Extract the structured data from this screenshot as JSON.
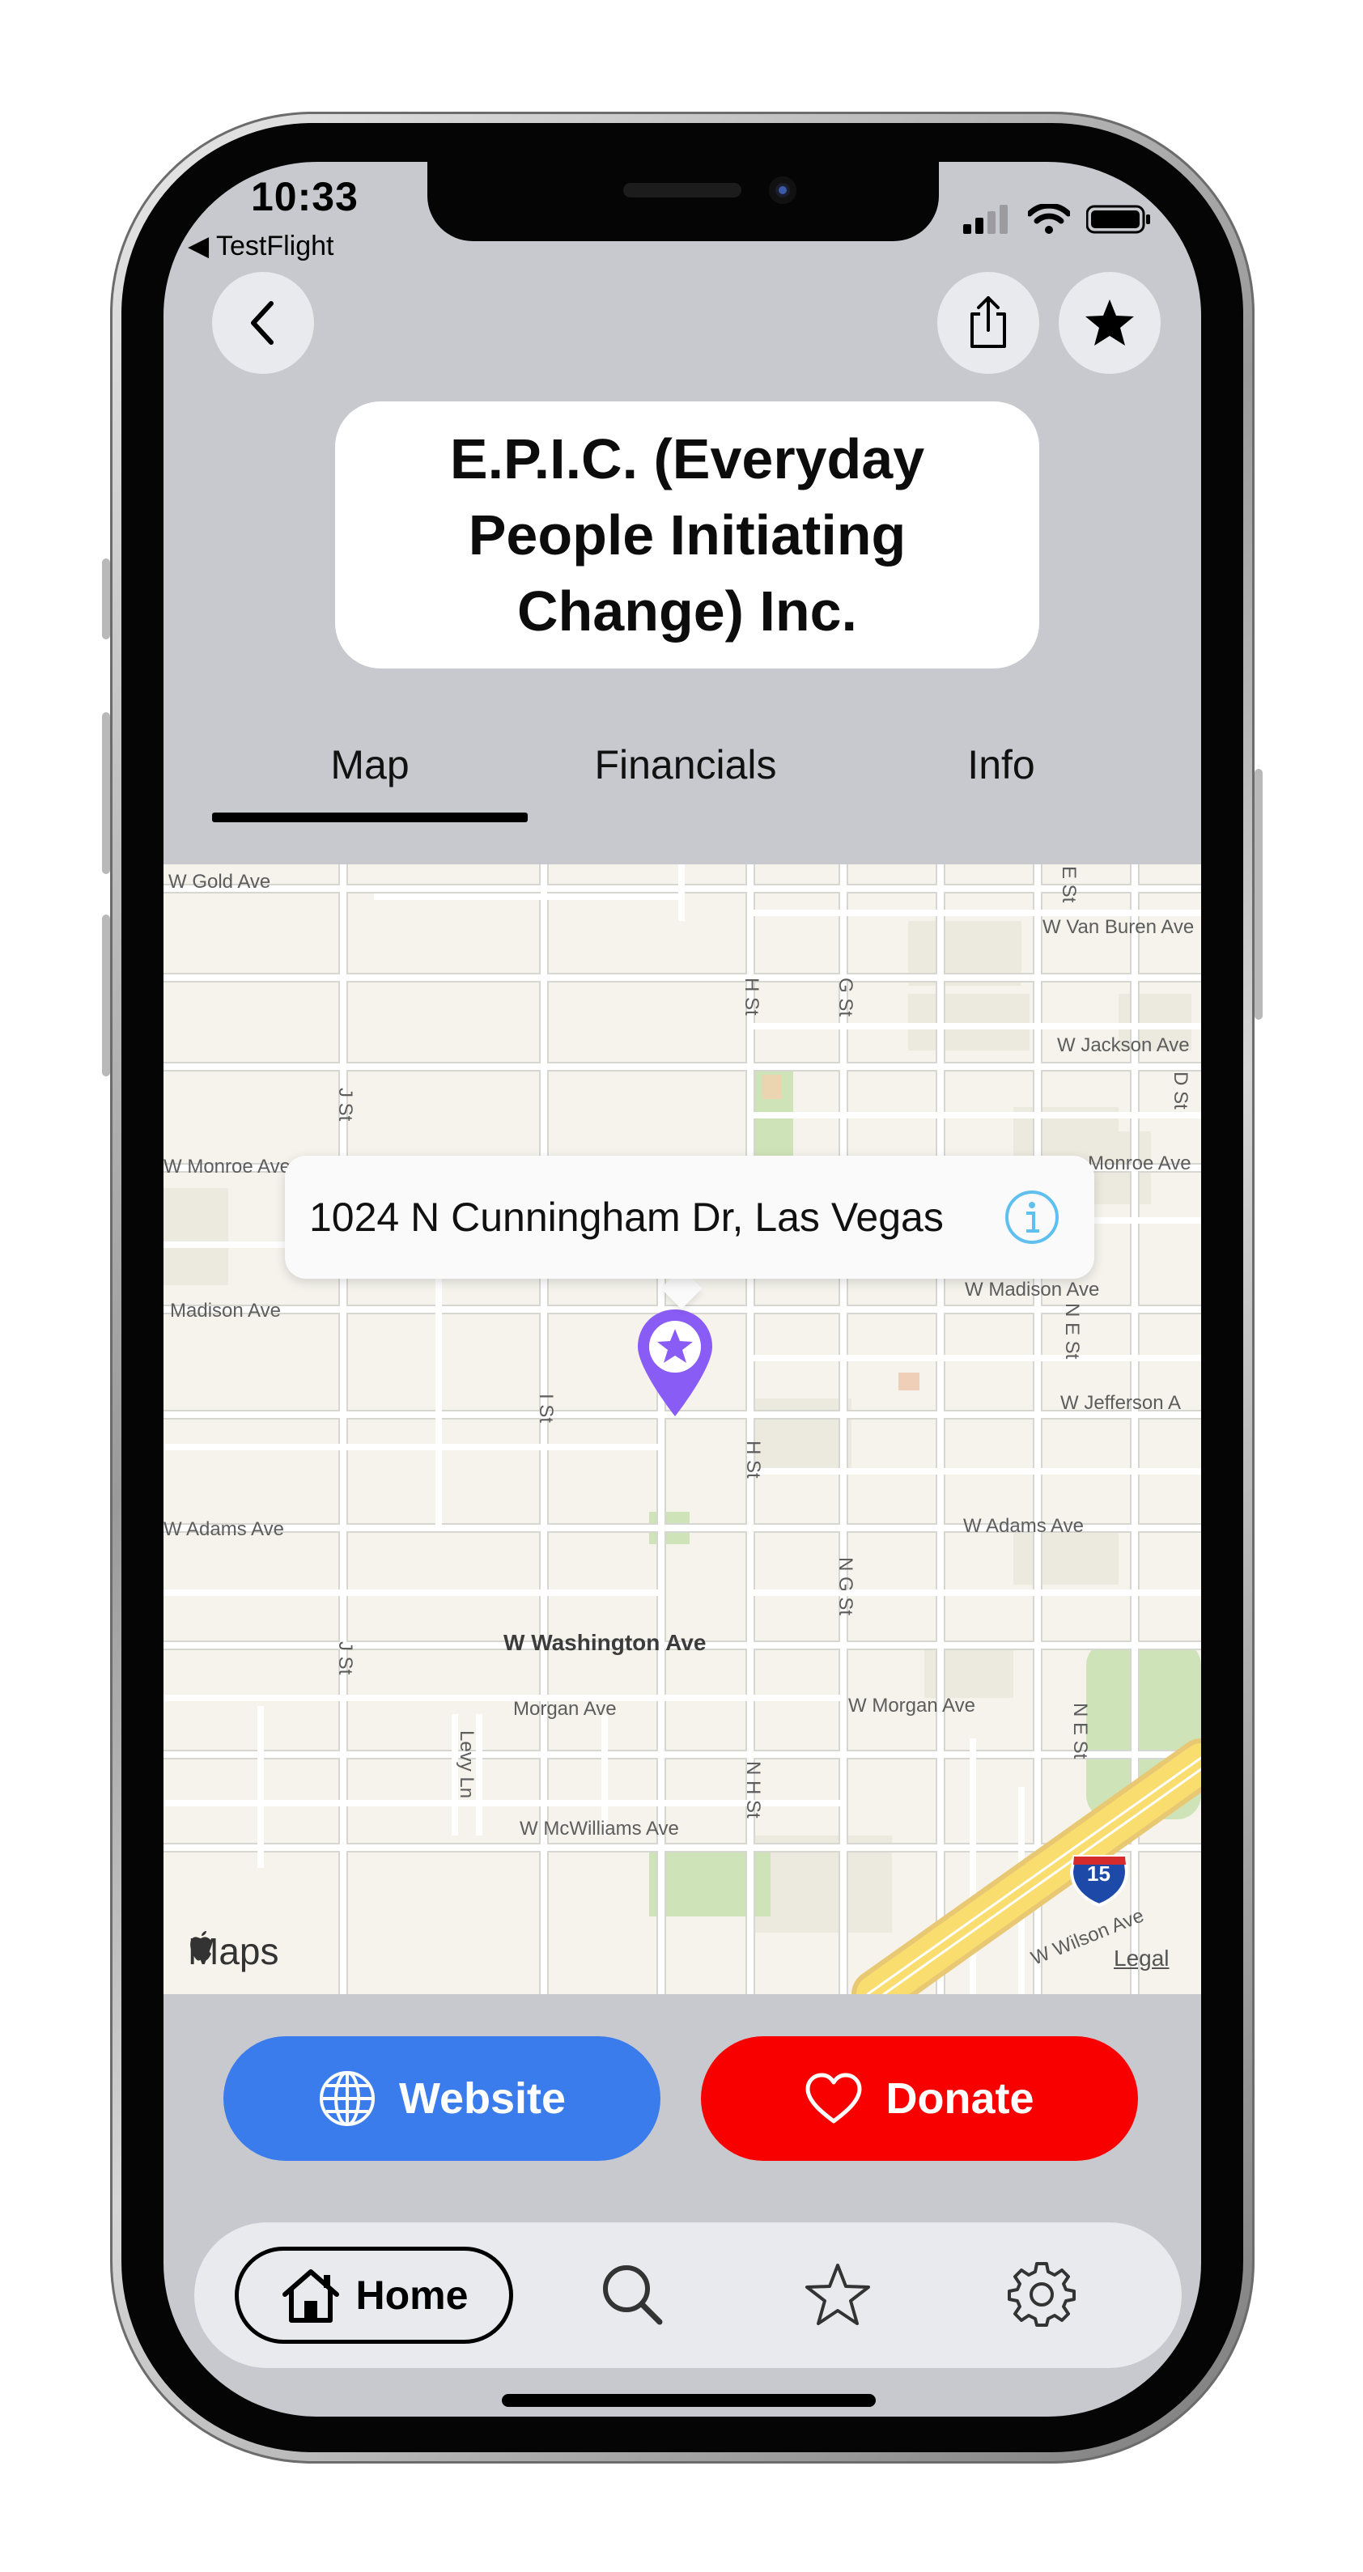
{
  "status_bar": {
    "time": "10:33",
    "back_app": "◀ TestFlight"
  },
  "nav": {
    "back_icon": "chevron-left-icon",
    "share_icon": "share-icon",
    "favorite_icon": "star-filled-icon"
  },
  "organization": {
    "name": "E.P.I.C. (Everyday\nPeople Initiating\nChange) Inc."
  },
  "tabs": [
    {
      "label": "Map",
      "selected": true
    },
    {
      "label": "Financials",
      "selected": false
    },
    {
      "label": "Info",
      "selected": false
    }
  ],
  "map": {
    "callout_address": "1024 N Cunningham Dr, Las Vegas",
    "callout_icon": "info-icon",
    "pin_color": "#8a5cf6",
    "attribution": "Maps",
    "legal": "Legal",
    "highway_shield": "15",
    "street_labels": {
      "gold": "W Gold Ave",
      "van_buren": "W Van Buren Ave",
      "jackson": "W Jackson Ave",
      "monroe_w": "W Monroe Ave",
      "monroe_e": "Monroe Ave",
      "madison_w": "Madison Ave",
      "madison_e": "W Madison Ave",
      "jefferson": "W Jefferson A",
      "adams_w": "W Adams Ave",
      "adams_e": "W Adams Ave",
      "washington": "W Washington Ave",
      "morgan": "Morgan Ave",
      "morgan_e": "W Morgan Ave",
      "mcwilliams": "W McWilliams Ave",
      "wilson": "W Wilson Ave",
      "h_st": "H St",
      "g_st": "G St",
      "e_st": "E St",
      "d_st": "D St",
      "j_st": "J St",
      "i_st": "I St",
      "h_st_2": "H St",
      "n_g_st": "N G St",
      "n_e_st": "N E St",
      "j_st_2": "J St",
      "levy": "Levy Ln",
      "n_h_st": "N H St",
      "n_e_st_2": "N E St"
    }
  },
  "actions": {
    "website": {
      "label": "Website",
      "color": "#3b7ced",
      "icon": "globe-icon"
    },
    "donate": {
      "label": "Donate",
      "color": "#f90000",
      "icon": "heart-icon"
    }
  },
  "tab_bar": {
    "home_label": "Home",
    "items": [
      "home-icon",
      "search-icon",
      "star-icon",
      "gear-icon"
    ]
  }
}
